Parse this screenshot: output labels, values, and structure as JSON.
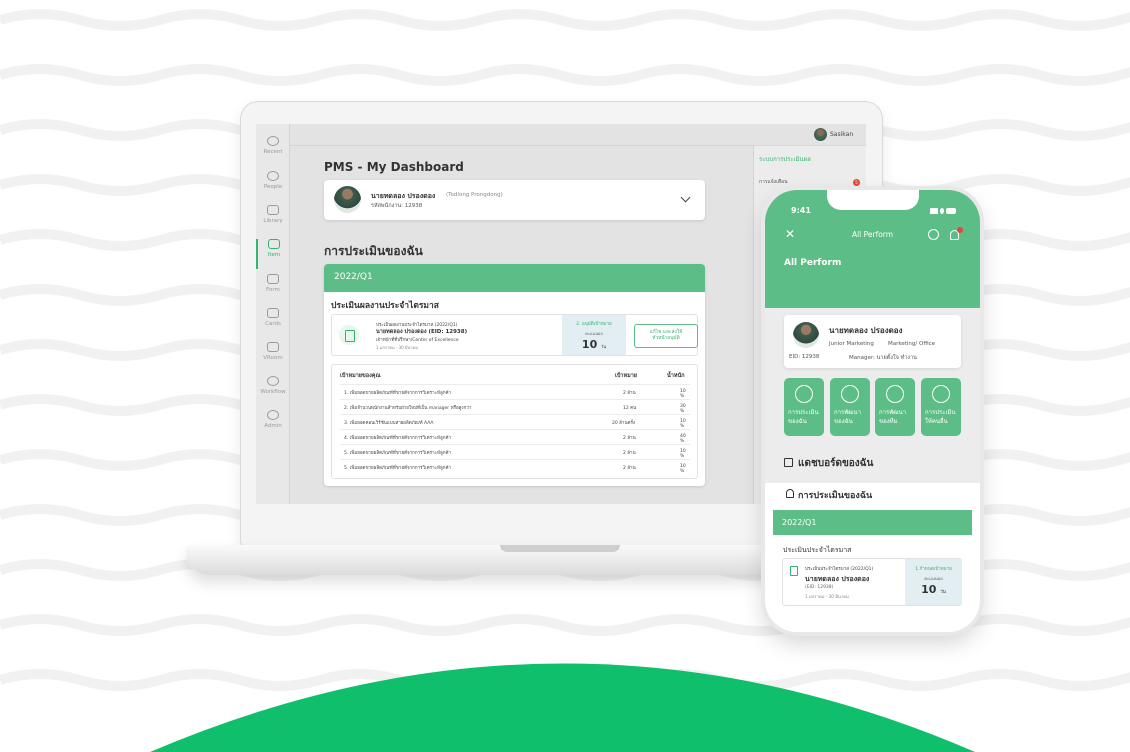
{
  "desktop": {
    "sidebar": [
      {
        "label": "Recent",
        "icon": "clock-icon"
      },
      {
        "label": "People",
        "icon": "people-icon"
      },
      {
        "label": "Library",
        "icon": "book-icon"
      },
      {
        "label": "Item",
        "icon": "wallet-icon"
      },
      {
        "label": "Form",
        "icon": "form-icon"
      },
      {
        "label": "Cards",
        "icon": "mail-icon"
      },
      {
        "label": "VRoom",
        "icon": "video-icon"
      },
      {
        "label": "Workflow",
        "icon": "workflow-icon"
      },
      {
        "label": "Admin",
        "icon": "admin-icon"
      }
    ],
    "username": "Sasikan",
    "page_title": "PMS - My Dashboard",
    "user": {
      "name": "นายทดลอง ปรองดอง",
      "name_en": "(Todlong Prongdong)",
      "employee_id": "รหัสพนักงาน: 12938"
    },
    "section_title": "การประเมินของฉัน",
    "quarter": "2022/Q1",
    "eval_subtitle": "ประเมินผลงานประจำไตรมาส",
    "eval_box": {
      "line1": "ประเมินผลงานประจำไตรมาส (2022/Q1)",
      "line2": "นายทดลอง ปรองดอง (EID: 12938)",
      "line3": "เจ้าหน้าที่ที่ปรึกษา/Center of Excellence",
      "line4": "1 มกราคม - 30 มีนาคม"
    },
    "score": {
      "label": "2. อนุมัติเป้าหมาย",
      "sublabel": "คะแนนผล",
      "value": "10",
      "unit": "วัน"
    },
    "action_button": {
      "line1": "แก้ไข และส่งให้",
      "line2": "หัวหน้าอนุมัติ"
    },
    "goals": {
      "headers": [
        "เป้าหมายของคุณ",
        "เป้าหมาย",
        "น้ำหนัก"
      ],
      "rows": [
        [
          "1. เพิ่มยอดขายผลิตภัณฑ์ที่ขายดีจากการวิเคราะห์ลูกค้า",
          "2 ล้าน",
          "10 %"
        ],
        [
          "2. เพิ่มจำนวนพนักงานสำหรับฝ่ายใหม่ที่เป็น manager หรือสูงกว่า",
          "12 คน",
          "30 %"
        ],
        [
          "3. เพิ่มยอดคอนเวิร์ชันแบบสายผลิตภัณฑ์ AAA",
          "20 ล้านครั้ง",
          "10 %"
        ],
        [
          "4. เพิ่มยอดขายผลิตภัณฑ์ที่ขายดีจากการวิเคราะห์ลูกค้า",
          "2 ล้าน",
          "40 %"
        ],
        [
          "5. เพิ่มยอดขายผลิตภัณฑ์ที่ขายดีจากการวิเคราะห์ลูกค้า",
          "2 ล้าน",
          "10 %"
        ],
        [
          "5. เพิ่มยอดขายผลิตภัณฑ์ที่ขายดีจากการวิเคราะห์ลูกค้า",
          "2 ล้าน",
          "10 %"
        ]
      ]
    },
    "right_panel": {
      "title": "ระบบการประเมินผล",
      "notif_label": "การแจ้งเตือน",
      "notif_count": "5"
    }
  },
  "mobile": {
    "time": "9:41",
    "header_title": "All Perform",
    "subtitle": "All Perform",
    "user": {
      "name": "นายทดลอง ปรองดอง",
      "role": "Junior Marketing",
      "dept": "Marketing/ Office",
      "eid": "EID: 12938",
      "manager": "Manager: นายตั้งใจ ทำงาน"
    },
    "tiles": [
      {
        "line1": "การประเมิน",
        "line2": "ของฉัน"
      },
      {
        "line1": "การพัฒนา",
        "line2": "ของฉัน"
      },
      {
        "line1": "การพัฒนา",
        "line2": "ของทีม"
      },
      {
        "line1": "การประเมิน",
        "line2": "ให้คนอื่น"
      }
    ],
    "dashboard_title": "แดชบอร์ดของฉัน",
    "my_eval_title": "การประเมินของฉัน",
    "quarter": "2022/Q1",
    "eval_subtitle": "ประเมินประจำไตรมาส",
    "eval_box": {
      "line1": "ประเมินประจำไตรมาส (2022/Q1)",
      "line2": "นายทดลอง ปรองดอง",
      "line3": "(EID: 12938)",
      "line4": "1 มกราคม - 30 มีนาคม"
    },
    "score": {
      "label": "1.กำหนดเป้าหมาย",
      "sublabel": "คะแนนผล",
      "value": "10",
      "unit": "วัน"
    }
  },
  "colors": {
    "brand_green": "#5dbd86",
    "accent_green": "#36b370",
    "hill_green": "#0fbf6b"
  }
}
